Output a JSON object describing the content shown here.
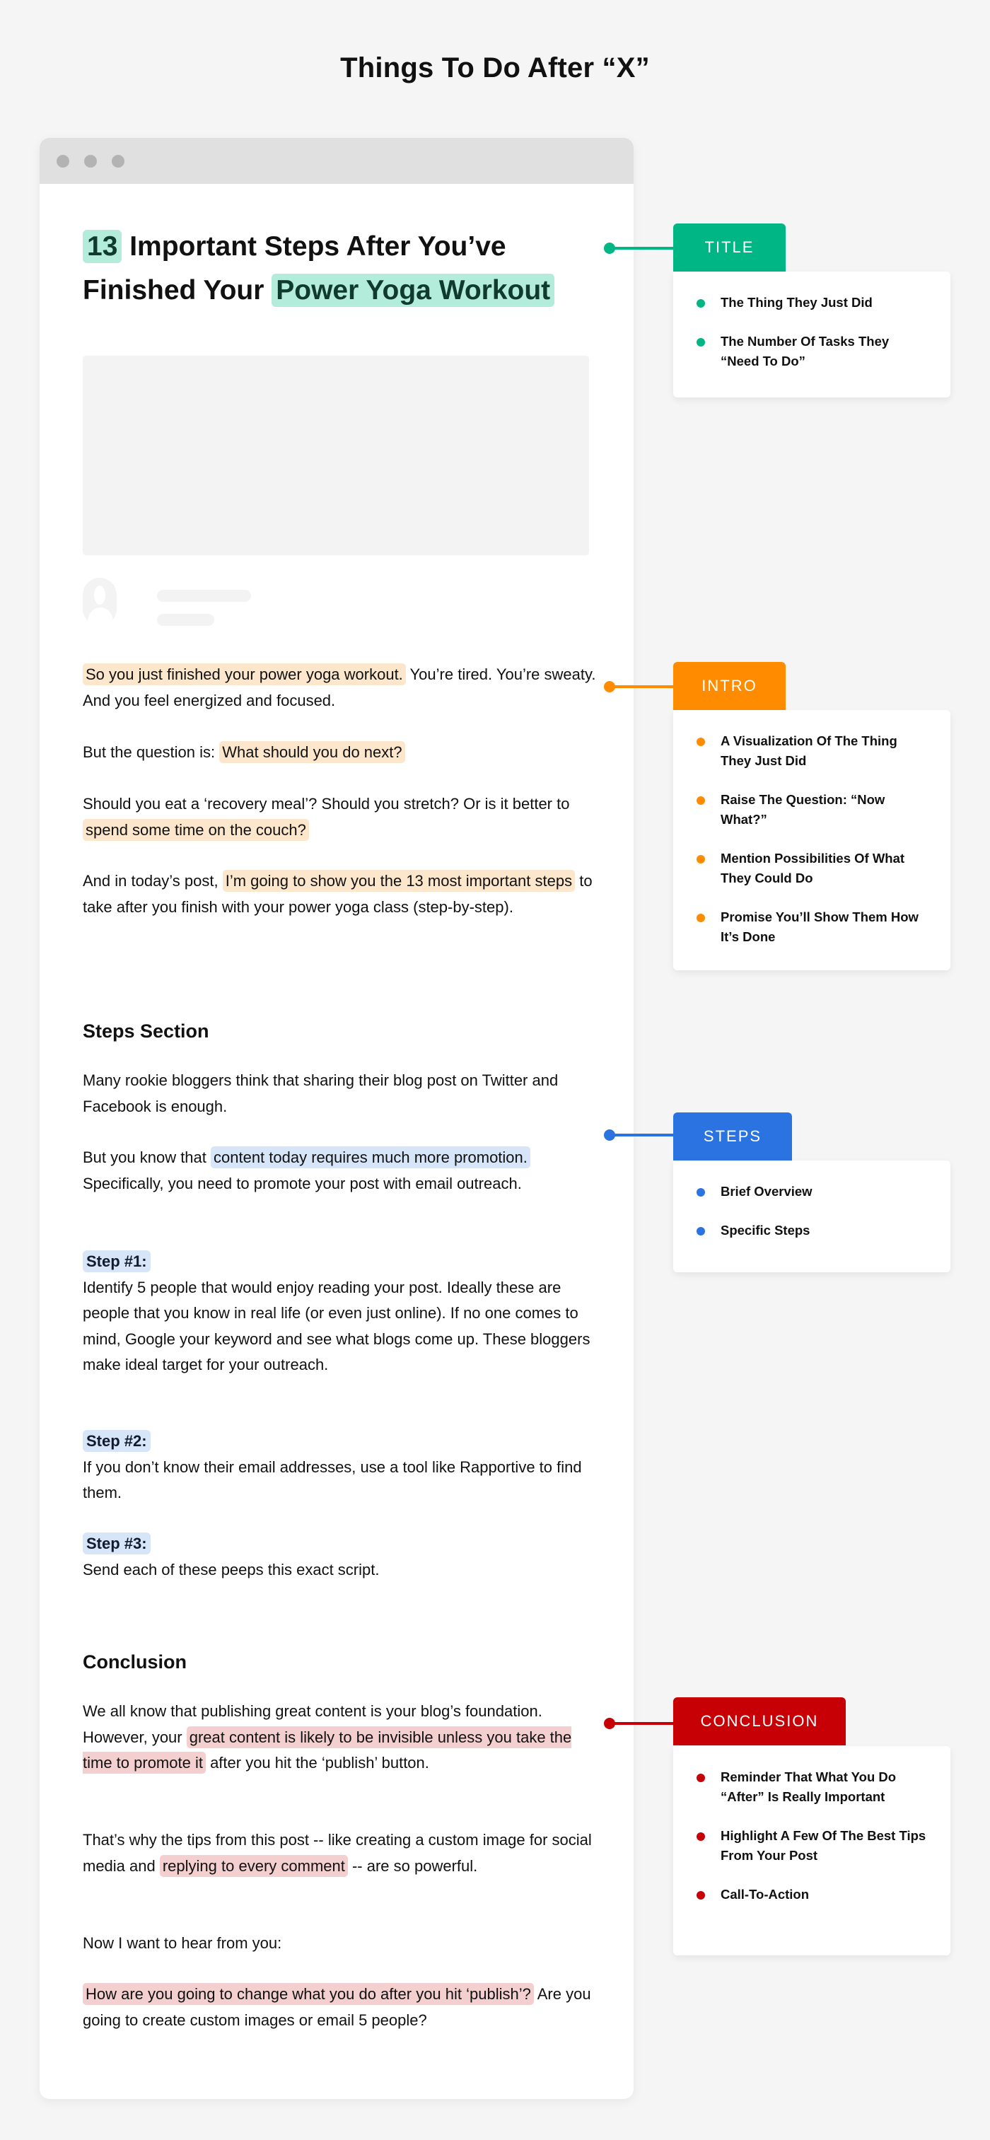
{
  "page_title": "Things To Do After “X”",
  "colors": {
    "title": "#00b684",
    "intro": "#ff8c00",
    "steps": "#2b73e0",
    "conclusion": "#c70006"
  },
  "browser_window": {
    "dots": [
      "window-dot",
      "window-dot",
      "window-dot"
    ],
    "post": {
      "title": {
        "highlight_number": "13",
        "line1_rest": " Important Steps After You’ve",
        "line2_prefix": "Finished Your ",
        "highlight_activity": "Power Yoga Workout"
      },
      "featured_image": "image-placeholder",
      "author": "avatar-placeholder",
      "intro": [
        {
          "segments": [
            {
              "text": "So you just finished your power yoga workout.",
              "hl": true
            },
            {
              "text": " You’re tired. You’re sweaty. And you feel energized and focused.",
              "hl": false
            }
          ]
        },
        {
          "segments": [
            {
              "text": "But the question is:  ",
              "hl": false
            },
            {
              "text": "What should you do next?",
              "hl": true
            }
          ]
        },
        {
          "segments": [
            {
              "text": "Should you eat a ‘recovery meal’? Should you stretch? Or is it better to ",
              "hl": false
            },
            {
              "text": "spend some time on the couch?",
              "hl": true
            }
          ]
        },
        {
          "segments": [
            {
              "text": "And in today’s post, ",
              "hl": false
            },
            {
              "text": "I’m going to show you the 13 most important steps",
              "hl": true
            },
            {
              "text": " to take after you finish with your power yoga class (step-by-step).",
              "hl": false
            }
          ]
        }
      ],
      "steps_section": {
        "heading": "Steps Section",
        "p1": "Many rookie bloggers think that sharing their blog post on Twitter and Facebook is enough.",
        "p2_prefix": "But you know that ",
        "p2_highlight": "content today requires much more promotion.",
        "p2_suffix": " Specifically, you need to promote your post with email outreach.",
        "steps": [
          {
            "label": "Step #1:",
            "text": "Identify 5 people that would enjoy reading your post. Ideally these are people that you know in real life (or even just online). If no one comes to mind, Google your keyword and see what blogs come up. These bloggers make ideal target for your outreach."
          },
          {
            "label": "Step #2:",
            "text": "If you don’t know their email addresses, use a tool like Rapportive to find them."
          },
          {
            "label": "Step #3:",
            "text": "Send each of these peeps this exact script."
          }
        ]
      },
      "conclusion": {
        "heading": "Conclusion",
        "p1_prefix": "We all know that publishing great content is your blog’s foundation. However, your ",
        "p1_highlight": "great content is likely to be invisible unless you take the time to promote it",
        "p1_suffix": " after you hit the ‘publish’ button.",
        "p2_prefix": "That’s why the tips from this post -- like creating a custom image for social media and ",
        "p2_highlight": "replying to every comment",
        "p2_suffix": " -- are so powerful.",
        "p3": "Now I want to hear from you:",
        "p4_highlight": "How are you going to change what you do after you hit ‘publish’?",
        "p4_suffix": " Are you going to create custom images or email 5 people?"
      }
    }
  },
  "annotations": [
    {
      "label": "TITLE",
      "color_key": "title",
      "items": [
        "The Thing They Just Did",
        "The Number Of Tasks They “Need To Do”"
      ]
    },
    {
      "label": "INTRO",
      "color_key": "intro",
      "items": [
        "A Visualization Of The Thing They Just Did",
        "Raise The Question: “Now What?”",
        "Mention Possibilities Of What They Could Do",
        "Promise You’ll Show Them How It’s Done"
      ]
    },
    {
      "label": "STEPS",
      "color_key": "steps",
      "items": [
        "Brief Overview",
        "Specific Steps"
      ]
    },
    {
      "label": "CONCLUSION",
      "color_key": "conclusion",
      "items": [
        "Reminder That What You Do “After” Is Really Important",
        "Highlight A Few Of The Best Tips From Your Post",
        "Call-To-Action"
      ]
    }
  ]
}
